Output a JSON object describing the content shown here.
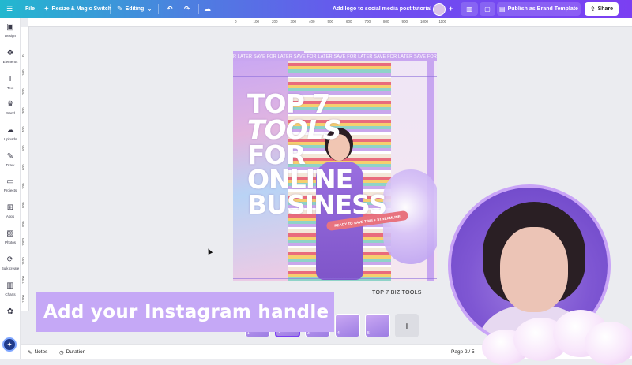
{
  "topbar": {
    "file_label": "File",
    "resize_label": "Resize & Magic Switch",
    "mode_label": "Editing",
    "doc_title": "Add logo to social media post tutorial",
    "publish_label": "Publish as Brand Template",
    "share_label": "Share"
  },
  "sidebar": {
    "items": [
      {
        "label": "Design",
        "icon": "design-icon",
        "glyph": "▣"
      },
      {
        "label": "Elements",
        "icon": "elements-icon",
        "glyph": "❖"
      },
      {
        "label": "Text",
        "icon": "text-icon",
        "glyph": "T"
      },
      {
        "label": "Brand",
        "icon": "brand-icon",
        "glyph": "♛"
      },
      {
        "label": "Uploads",
        "icon": "uploads-icon",
        "glyph": "☁"
      },
      {
        "label": "Draw",
        "icon": "draw-icon",
        "glyph": "✎"
      },
      {
        "label": "Projects",
        "icon": "projects-icon",
        "glyph": "▭"
      },
      {
        "label": "Apps",
        "icon": "apps-icon",
        "glyph": "⊞"
      },
      {
        "label": "Photos",
        "icon": "photos-icon",
        "glyph": "▨"
      },
      {
        "label": "Bulk create",
        "icon": "bulk-create-icon",
        "glyph": "⟳"
      },
      {
        "label": "Charts",
        "icon": "charts-icon",
        "glyph": "▥"
      },
      {
        "label": "",
        "icon": "more-icon",
        "glyph": "✿"
      }
    ]
  },
  "ruler": {
    "top": [
      "0",
      "100",
      "200",
      "300",
      "400",
      "500",
      "600",
      "700",
      "800",
      "900",
      "1000",
      "1100"
    ],
    "left": [
      "0",
      "100",
      "200",
      "300",
      "400",
      "500",
      "600",
      "700",
      "800",
      "900",
      "1000",
      "1100",
      "1200",
      "1300"
    ]
  },
  "design": {
    "banner": "R LATER SAVE FOR LATER SAVE FOR LATER SAVE FOR LATER SAVE FOR LATER SAVE FOR LATER SAVE FOR LATER",
    "title_lines": [
      "TOP 7",
      "TOOLS",
      "FOR",
      "ONLINE",
      "BUSINESS"
    ],
    "sticker": "READY TO SAVE TIME + STREAMLINE",
    "footer": "TOP 7 BIZ TOOLS"
  },
  "pages": {
    "thumb_numbers": [
      "1",
      "2",
      "3",
      "4",
      "5"
    ],
    "active_index": 1
  },
  "bottombar": {
    "notes_label": "Notes",
    "duration_label": "Duration",
    "page_indicator": "Page 2 / 5"
  },
  "overlay": {
    "caption": "Add your Instagram handle"
  },
  "colors": {
    "accent": "#7b3ff2",
    "caption_bg": "#c5a8f6",
    "gradient_start": "#22b8cf",
    "gradient_end": "#7b3ff2"
  }
}
